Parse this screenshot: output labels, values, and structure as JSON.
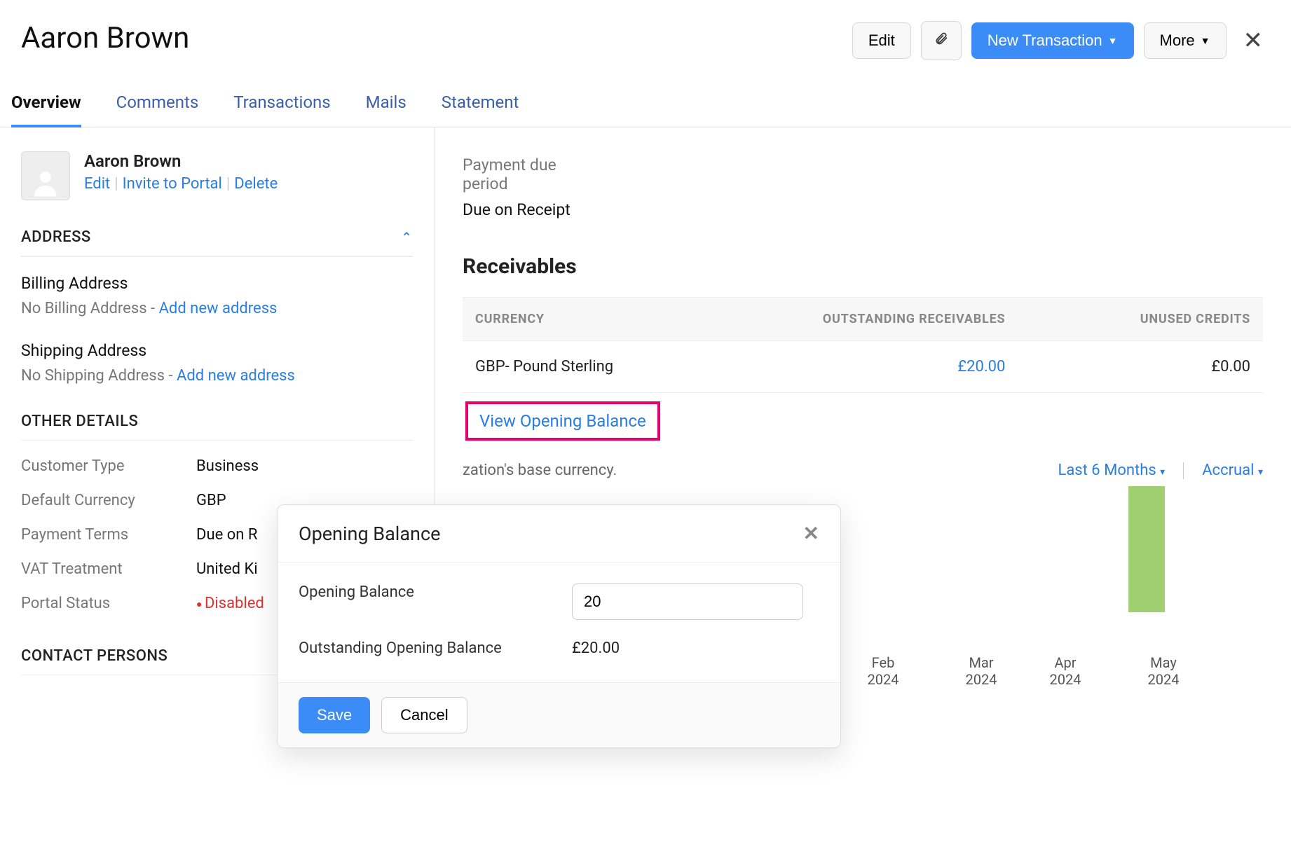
{
  "header": {
    "title": "Aaron Brown",
    "edit": "Edit",
    "new_transaction": "New Transaction",
    "more": "More"
  },
  "tabs": [
    "Overview",
    "Comments",
    "Transactions",
    "Mails",
    "Statement"
  ],
  "profile": {
    "name": "Aaron Brown",
    "edit": "Edit",
    "invite": "Invite to Portal",
    "delete": "Delete"
  },
  "address": {
    "heading": "ADDRESS",
    "billing_title": "Billing Address",
    "billing_text": "No Billing Address - ",
    "billing_link": "Add new address",
    "shipping_title": "Shipping Address",
    "shipping_text": "No Shipping Address - ",
    "shipping_link": "Add new address"
  },
  "other": {
    "heading": "OTHER DETAILS",
    "rows": [
      {
        "label": "Customer Type",
        "value": "Business"
      },
      {
        "label": "Default Currency",
        "value": "GBP"
      },
      {
        "label": "Payment Terms",
        "value": "Due on R"
      },
      {
        "label": "VAT Treatment",
        "value": "United Ki"
      },
      {
        "label": "Portal Status",
        "value": "Disabled",
        "red": true
      }
    ]
  },
  "contact_persons_heading": "CONTACT PERSONS",
  "main": {
    "payment_due_label": "Payment due period",
    "payment_due_value": "Due on Receipt",
    "receivables_heading": "Receivables",
    "table": {
      "headers": [
        "CURRENCY",
        "OUTSTANDING RECEIVABLES",
        "UNUSED CREDITS"
      ],
      "row": [
        "GBP- Pound Sterling",
        "£20.00",
        "£0.00"
      ]
    },
    "view_opening": "View Opening Balance",
    "base_currency_note": "zation's base currency.",
    "range_dropdown": "Last 6 Months",
    "basis_dropdown": "Accrual"
  },
  "chart_data": {
    "type": "bar",
    "categories": [
      "Feb 2024",
      "Mar 2024",
      "Apr 2024",
      "May 2024"
    ],
    "values": [
      0,
      0,
      0,
      20
    ],
    "xticks": [
      {
        "top": "Feb",
        "bottom": "2024"
      },
      {
        "top": "Mar",
        "bottom": "2024"
      },
      {
        "top": "Apr",
        "bottom": "2024"
      },
      {
        "top": "May",
        "bottom": "2024"
      }
    ]
  },
  "dialog": {
    "title": "Opening Balance",
    "opening_balance_label": "Opening Balance",
    "opening_balance_value": "20",
    "outstanding_label": "Outstanding Opening Balance",
    "outstanding_value": "£20.00",
    "save": "Save",
    "cancel": "Cancel"
  }
}
